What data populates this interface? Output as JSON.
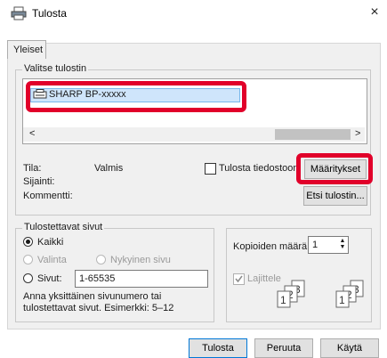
{
  "window": {
    "title": "Tulosta",
    "close": "×"
  },
  "tabs": [
    {
      "label": "Yleiset"
    }
  ],
  "select_printer": {
    "legend": "Valitse tulostin",
    "printer_name": "SHARP BP-xxxxx",
    "scroll_left": "<",
    "scroll_right": ">"
  },
  "status": {
    "state_label": "Tila:",
    "state_value": "Valmis",
    "location_label": "Sijainti:",
    "comment_label": "Kommentti:",
    "print_to_file_label": "Tulosta tiedostoon",
    "print_to_file_checked": false,
    "preferences_button": "Määritykset",
    "find_printer_button": "Etsi tulostin..."
  },
  "page_range": {
    "legend": "Tulostettavat sivut",
    "all_label": "Kaikki",
    "selection_label": "Valinta",
    "current_page_label": "Nykyinen sivu",
    "pages_label": "Sivut:",
    "pages_value": "1-65535",
    "hint_line1": "Anna yksittäinen sivunumero tai",
    "hint_line2": "tulostettavat sivut. Esimerkki: 5–12",
    "selected": "all"
  },
  "copies": {
    "count_label": "Kopioiden määrä:",
    "count_value": "1",
    "collate_label": "Lajittele",
    "collate_checked": true
  },
  "footer": {
    "print_button": "Tulosta",
    "cancel_button": "Peruuta",
    "apply_button": "Käytä"
  },
  "colors": {
    "highlight": "#e1002a",
    "selection": "#cfe5fb"
  }
}
